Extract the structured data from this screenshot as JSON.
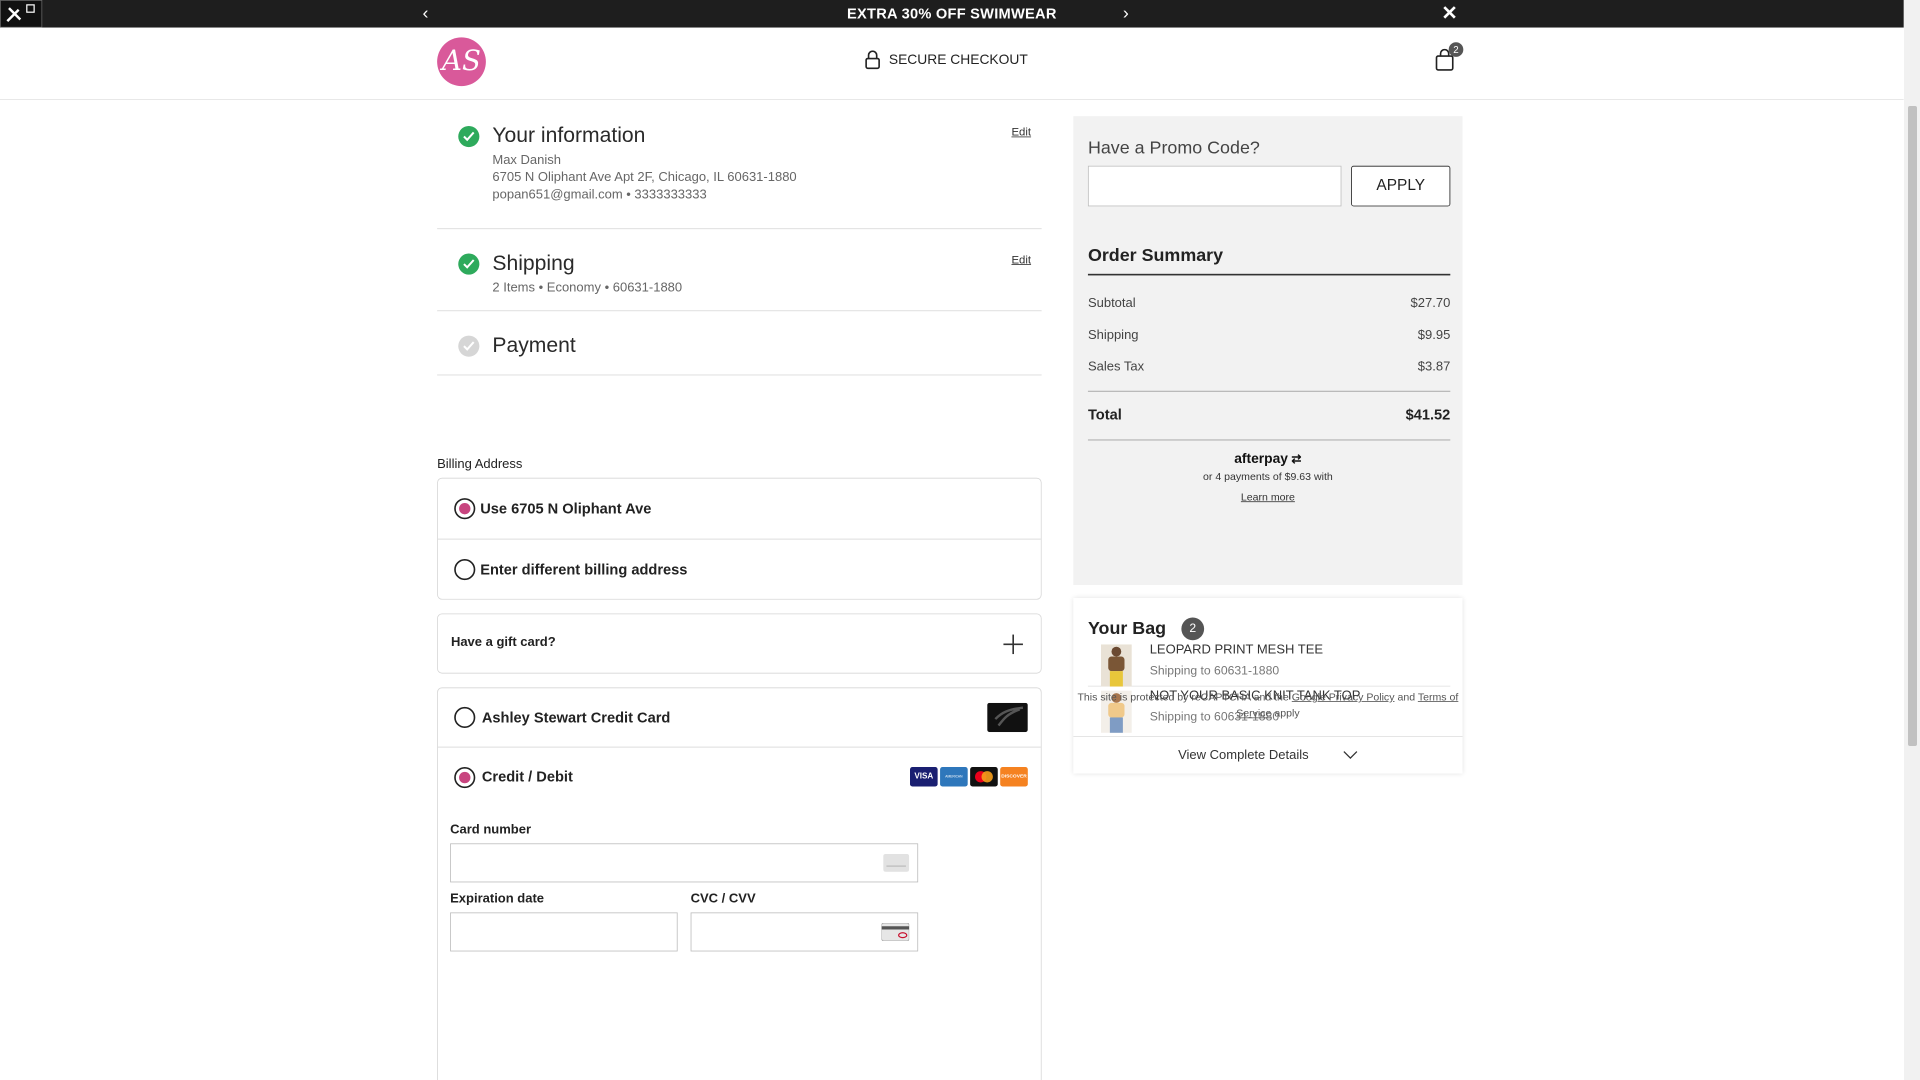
{
  "banner": {
    "text": "EXTRA 30% OFF SWIMWEAR",
    "prev": "‹",
    "next": "›",
    "close": "✕"
  },
  "header": {
    "logo": "AS",
    "secure": "SECURE CHECKOUT",
    "cart_count": "2"
  },
  "info": {
    "title": "Your information",
    "edit": "Edit",
    "name": "Max Danish",
    "address": "6705 N Oliphant Ave Apt 2F, Chicago, IL 60631-1880",
    "contact": "popan651@gmail.com • 3333333333"
  },
  "shipping": {
    "title": "Shipping",
    "edit": "Edit",
    "summary": "2 Items • Economy • 60631-1880"
  },
  "payment": {
    "title": "Payment"
  },
  "billing": {
    "label": "Billing Address",
    "use_address": "Use 6705 N Oliphant Ave",
    "different": "Enter different billing address"
  },
  "gift": {
    "label": "Have a gift card?"
  },
  "methods": {
    "store_card": "Ashley Stewart Credit Card",
    "credit": "Credit / Debit",
    "card_number": "Card number",
    "expiration": "Expiration date",
    "cvc": "CVC / CVV"
  },
  "brands": {
    "visa": "VISA",
    "amex": "AMERICAN EXPRESS",
    "discover": "DISCOVER"
  },
  "summary": {
    "promo_label": "Have a Promo Code?",
    "apply": "APPLY",
    "title": "Order Summary",
    "subtotal_label": "Subtotal",
    "subtotal": "$27.70",
    "shipping_label": "Shipping",
    "shipping": "$9.95",
    "tax_label": "Sales Tax",
    "tax": "$3.87",
    "total_label": "Total",
    "total": "$41.52",
    "afterpay_logo": "afterpay",
    "afterpay_text": "or 4 payments of $9.63 with",
    "learn_more": "Learn more"
  },
  "bag": {
    "title": "Your Bag",
    "count": "2",
    "items": [
      {
        "name": "LEOPARD PRINT MESH TEE",
        "ship": "Shipping to 60631-1880"
      },
      {
        "name": "NOT YOUR BASIC KNIT TANK TOP",
        "ship": "Shipping to 60631-1880"
      }
    ],
    "view": "View Complete Details"
  },
  "recaptcha": {
    "text1": "This site is protected by reCAPTCHA and the",
    "privacy": "Google Privacy Policy",
    "and": "and",
    "terms": "Terms of Service",
    "apply": "apply"
  },
  "colors": {
    "accent": "#c8457f",
    "brand": "#d9599a",
    "check": "#2eaa5c",
    "banner": "#1e1e1e"
  }
}
